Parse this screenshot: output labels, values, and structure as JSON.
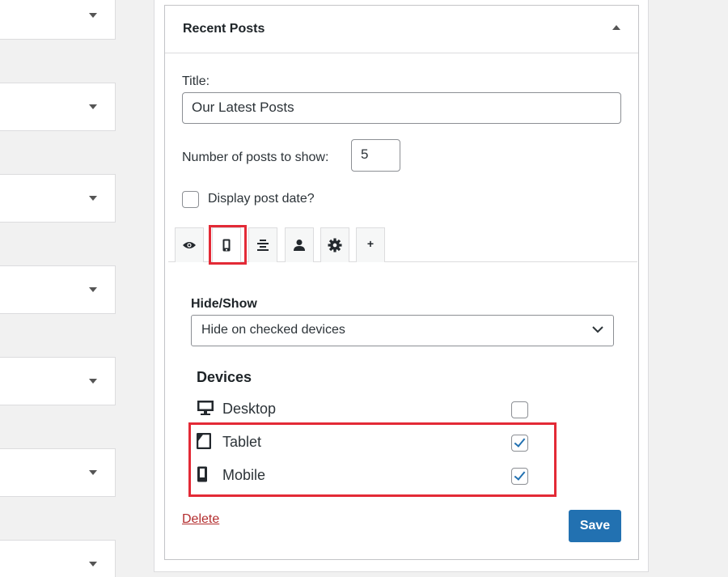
{
  "widget": {
    "title": "Recent Posts",
    "title_field_label": "Title:",
    "title_field_value": "Our Latest Posts",
    "num_posts_label": "Number of posts to show:",
    "num_posts_value": "5",
    "display_date_label": "Display post date?",
    "display_date_checked": false
  },
  "tabs": [
    {
      "icon": "eye-icon",
      "active": false
    },
    {
      "icon": "mobile-icon",
      "active": true
    },
    {
      "icon": "align-center-icon",
      "active": false
    },
    {
      "icon": "user-icon",
      "active": false
    },
    {
      "icon": "gear-icon",
      "active": false
    },
    {
      "icon": "plus-icon",
      "label": "+",
      "active": false
    }
  ],
  "visibility": {
    "hide_show_label": "Hide/Show",
    "select_value": "Hide on checked devices",
    "devices_label": "Devices",
    "devices": [
      {
        "icon": "desktop-icon",
        "label": "Desktop",
        "checked": false
      },
      {
        "icon": "tablet-icon",
        "label": "Tablet",
        "checked": true
      },
      {
        "icon": "mobile-icon",
        "label": "Mobile",
        "checked": true
      }
    ]
  },
  "actions": {
    "delete_label": "Delete",
    "save_label": "Save"
  },
  "colors": {
    "accent": "#2271b1",
    "highlight": "#e32a36",
    "delete": "#b32d2e"
  }
}
